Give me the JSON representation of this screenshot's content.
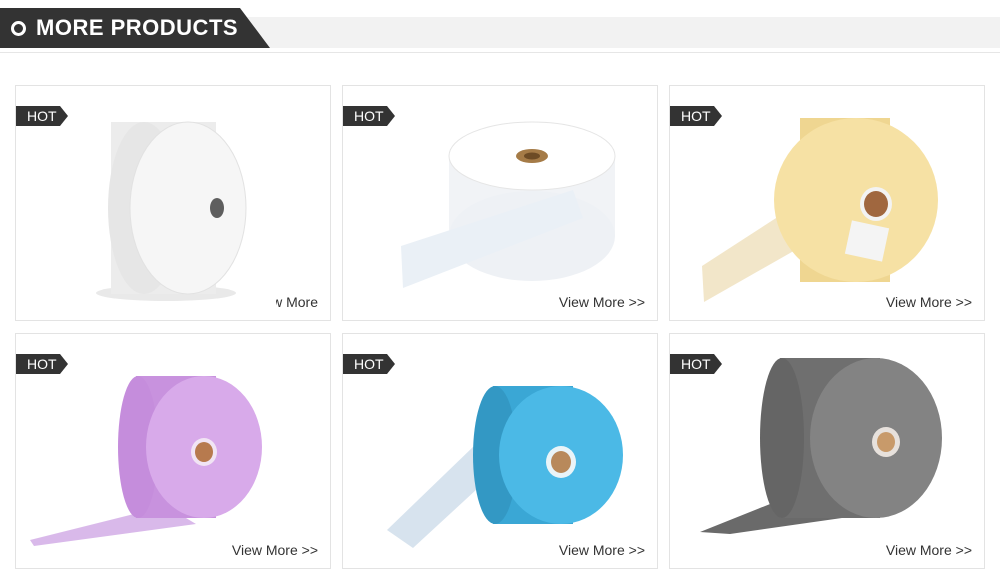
{
  "section": {
    "title": "MORE PRODUCTS"
  },
  "products": [
    {
      "badge": "HOT",
      "link": "View More >>",
      "color": "#f4f4f4",
      "core": "#6b6b6b",
      "image": "white-roll-icon"
    },
    {
      "badge": "HOT",
      "link": "View More >>",
      "color": "#f7f8fa",
      "core": "#a57b47",
      "image": "white-roll-unwound-icon"
    },
    {
      "badge": "HOT",
      "link": "View More >>",
      "color": "#f6e1a4",
      "core": "#8a5a36",
      "image": "yellow-roll-icon"
    },
    {
      "badge": "HOT",
      "link": "View More >>",
      "color": "#d7a8e6",
      "core": "#b77a4e",
      "image": "purple-roll-icon"
    },
    {
      "badge": "HOT",
      "link": "View More >>",
      "color": "#45b6e3",
      "core": "#b8895b",
      "image": "blue-roll-icon"
    },
    {
      "badge": "HOT",
      "link": "View More >>",
      "color": "#7f7f7f",
      "core": "#c89a6a",
      "image": "gray-roll-icon"
    }
  ]
}
